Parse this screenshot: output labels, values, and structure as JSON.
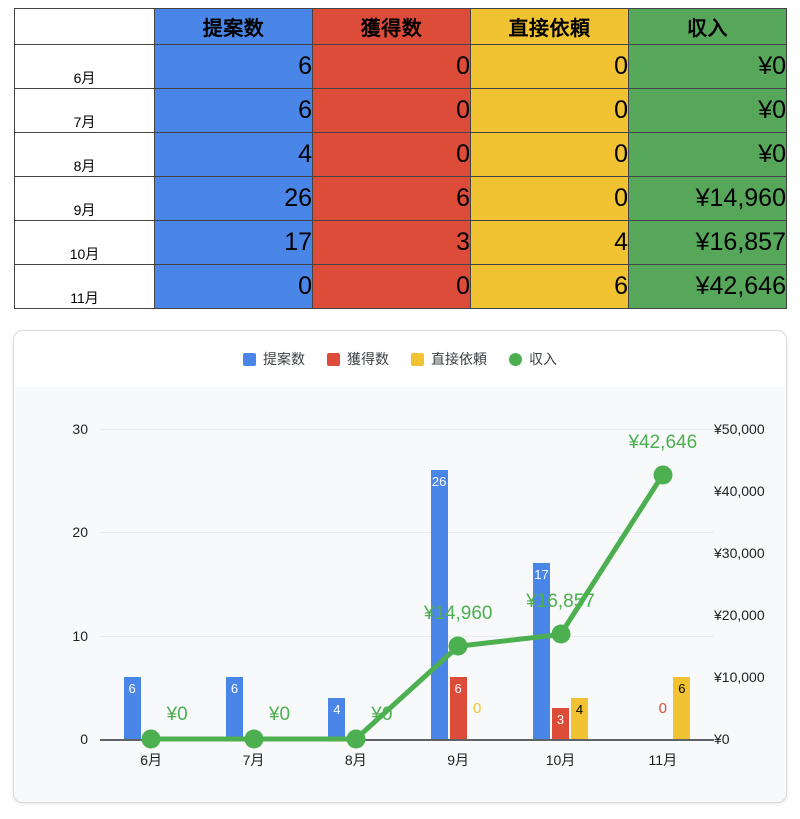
{
  "table": {
    "corner_label": "",
    "columns": [
      {
        "key": "proposals",
        "label": "提案数",
        "color": "#4a86e8"
      },
      {
        "key": "won",
        "label": "獲得数",
        "color": "#dd4b39"
      },
      {
        "key": "direct",
        "label": "直接依頼",
        "color": "#f1c232"
      },
      {
        "key": "income",
        "label": "収入",
        "color": "#56a75a"
      }
    ],
    "rows": [
      {
        "month": "6月",
        "proposals": "6",
        "won": "0",
        "direct": "0",
        "income": "¥0"
      },
      {
        "month": "7月",
        "proposals": "6",
        "won": "0",
        "direct": "0",
        "income": "¥0"
      },
      {
        "month": "8月",
        "proposals": "4",
        "won": "0",
        "direct": "0",
        "income": "¥0"
      },
      {
        "month": "9月",
        "proposals": "26",
        "won": "6",
        "direct": "0",
        "income": "¥14,960"
      },
      {
        "month": "10月",
        "proposals": "17",
        "won": "3",
        "direct": "4",
        "income": "¥16,857"
      },
      {
        "month": "11月",
        "proposals": "0",
        "won": "0",
        "direct": "6",
        "income": "¥42,646"
      }
    ]
  },
  "chart_panel": {
    "legend": [
      {
        "label": "提案数",
        "color": "#4a86e8",
        "shape": "square"
      },
      {
        "label": "獲得数",
        "color": "#dd4b39",
        "shape": "square"
      },
      {
        "label": "直接依頼",
        "color": "#f1c232",
        "shape": "square"
      },
      {
        "label": "収入",
        "color": "#4caf50",
        "shape": "circle"
      }
    ]
  },
  "chart_data": {
    "type": "bar",
    "title": "",
    "categories": [
      "6月",
      "7月",
      "8月",
      "9月",
      "10月",
      "11月"
    ],
    "series": [
      {
        "name": "提案数",
        "type": "bar",
        "axis": "left",
        "color": "#4a86e8",
        "values": [
          6,
          6,
          4,
          26,
          17,
          0
        ],
        "labels": [
          "6",
          "6",
          "4",
          "26",
          "17",
          "0"
        ]
      },
      {
        "name": "獲得数",
        "type": "bar",
        "axis": "left",
        "color": "#dd4b39",
        "values": [
          0,
          0,
          0,
          6,
          3,
          0
        ],
        "labels": [
          "0",
          "0",
          "0",
          "6",
          "3",
          "0"
        ]
      },
      {
        "name": "直接依頼",
        "type": "bar",
        "axis": "left",
        "color": "#f1c232",
        "values": [
          0,
          0,
          0,
          0,
          4,
          6
        ],
        "labels": [
          "0",
          "0",
          "0",
          "0",
          "4",
          "6"
        ]
      },
      {
        "name": "収入",
        "type": "line",
        "axis": "right",
        "color": "#4caf50",
        "values": [
          0,
          0,
          0,
          14960,
          16857,
          42646
        ],
        "labels": [
          "¥0",
          "¥0",
          "¥0",
          "¥14,960",
          "¥16,857",
          "¥42,646"
        ]
      }
    ],
    "left_axis": {
      "ticks": [
        "0",
        "10",
        "20",
        "30"
      ],
      "values": [
        0,
        10,
        20,
        30
      ],
      "min": 0,
      "max": 30
    },
    "right_axis": {
      "ticks": [
        "¥0",
        "¥10,000",
        "¥20,000",
        "¥30,000",
        "¥40,000",
        "¥50,000"
      ],
      "values": [
        0,
        10000,
        20000,
        30000,
        40000,
        50000
      ],
      "min": 0,
      "max": 50000
    },
    "xlabel": "",
    "ylabel": "",
    "grid": true,
    "legend_position": "top"
  }
}
